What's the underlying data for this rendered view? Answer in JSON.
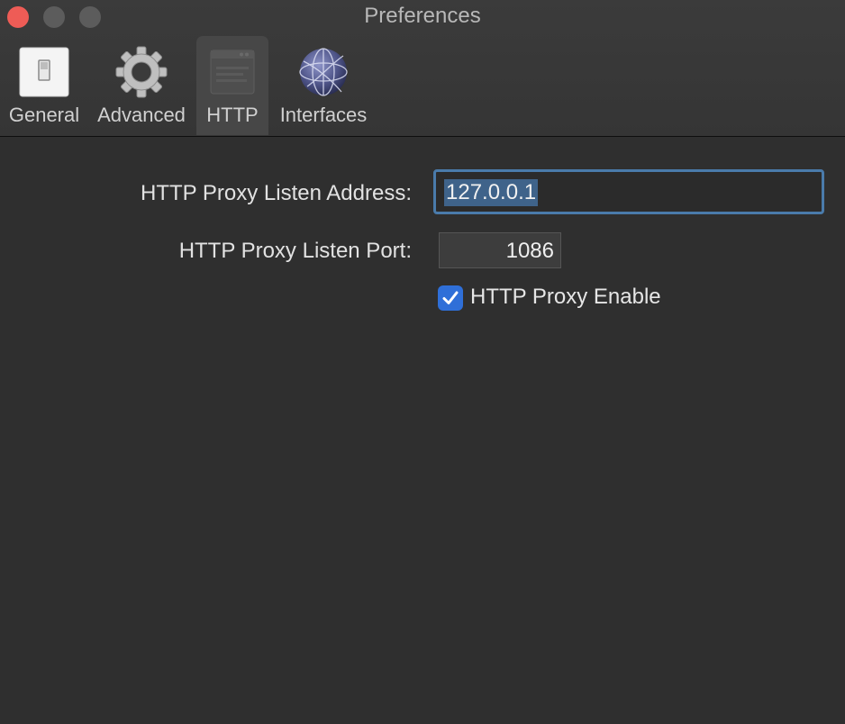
{
  "window": {
    "title": "Preferences"
  },
  "toolbar": {
    "tabs": [
      {
        "label": "General",
        "icon": "light-switch-icon"
      },
      {
        "label": "Advanced",
        "icon": "gear-icon"
      },
      {
        "label": "HTTP",
        "icon": "http-window-icon",
        "selected": true
      },
      {
        "label": "Interfaces",
        "icon": "globe-icon"
      }
    ]
  },
  "form": {
    "address_label": "HTTP Proxy Listen Address:",
    "address_value": "127.0.0.1",
    "port_label": "HTTP Proxy Listen Port:",
    "port_value": "1086",
    "enable_label": "HTTP Proxy Enable",
    "enable_checked": true
  },
  "colors": {
    "background": "#2f2f2f",
    "focus_ring": "#4a7bab",
    "selection": "#3f638a",
    "checkbox": "#2f6fd8",
    "close_button": "#ee5c56"
  }
}
